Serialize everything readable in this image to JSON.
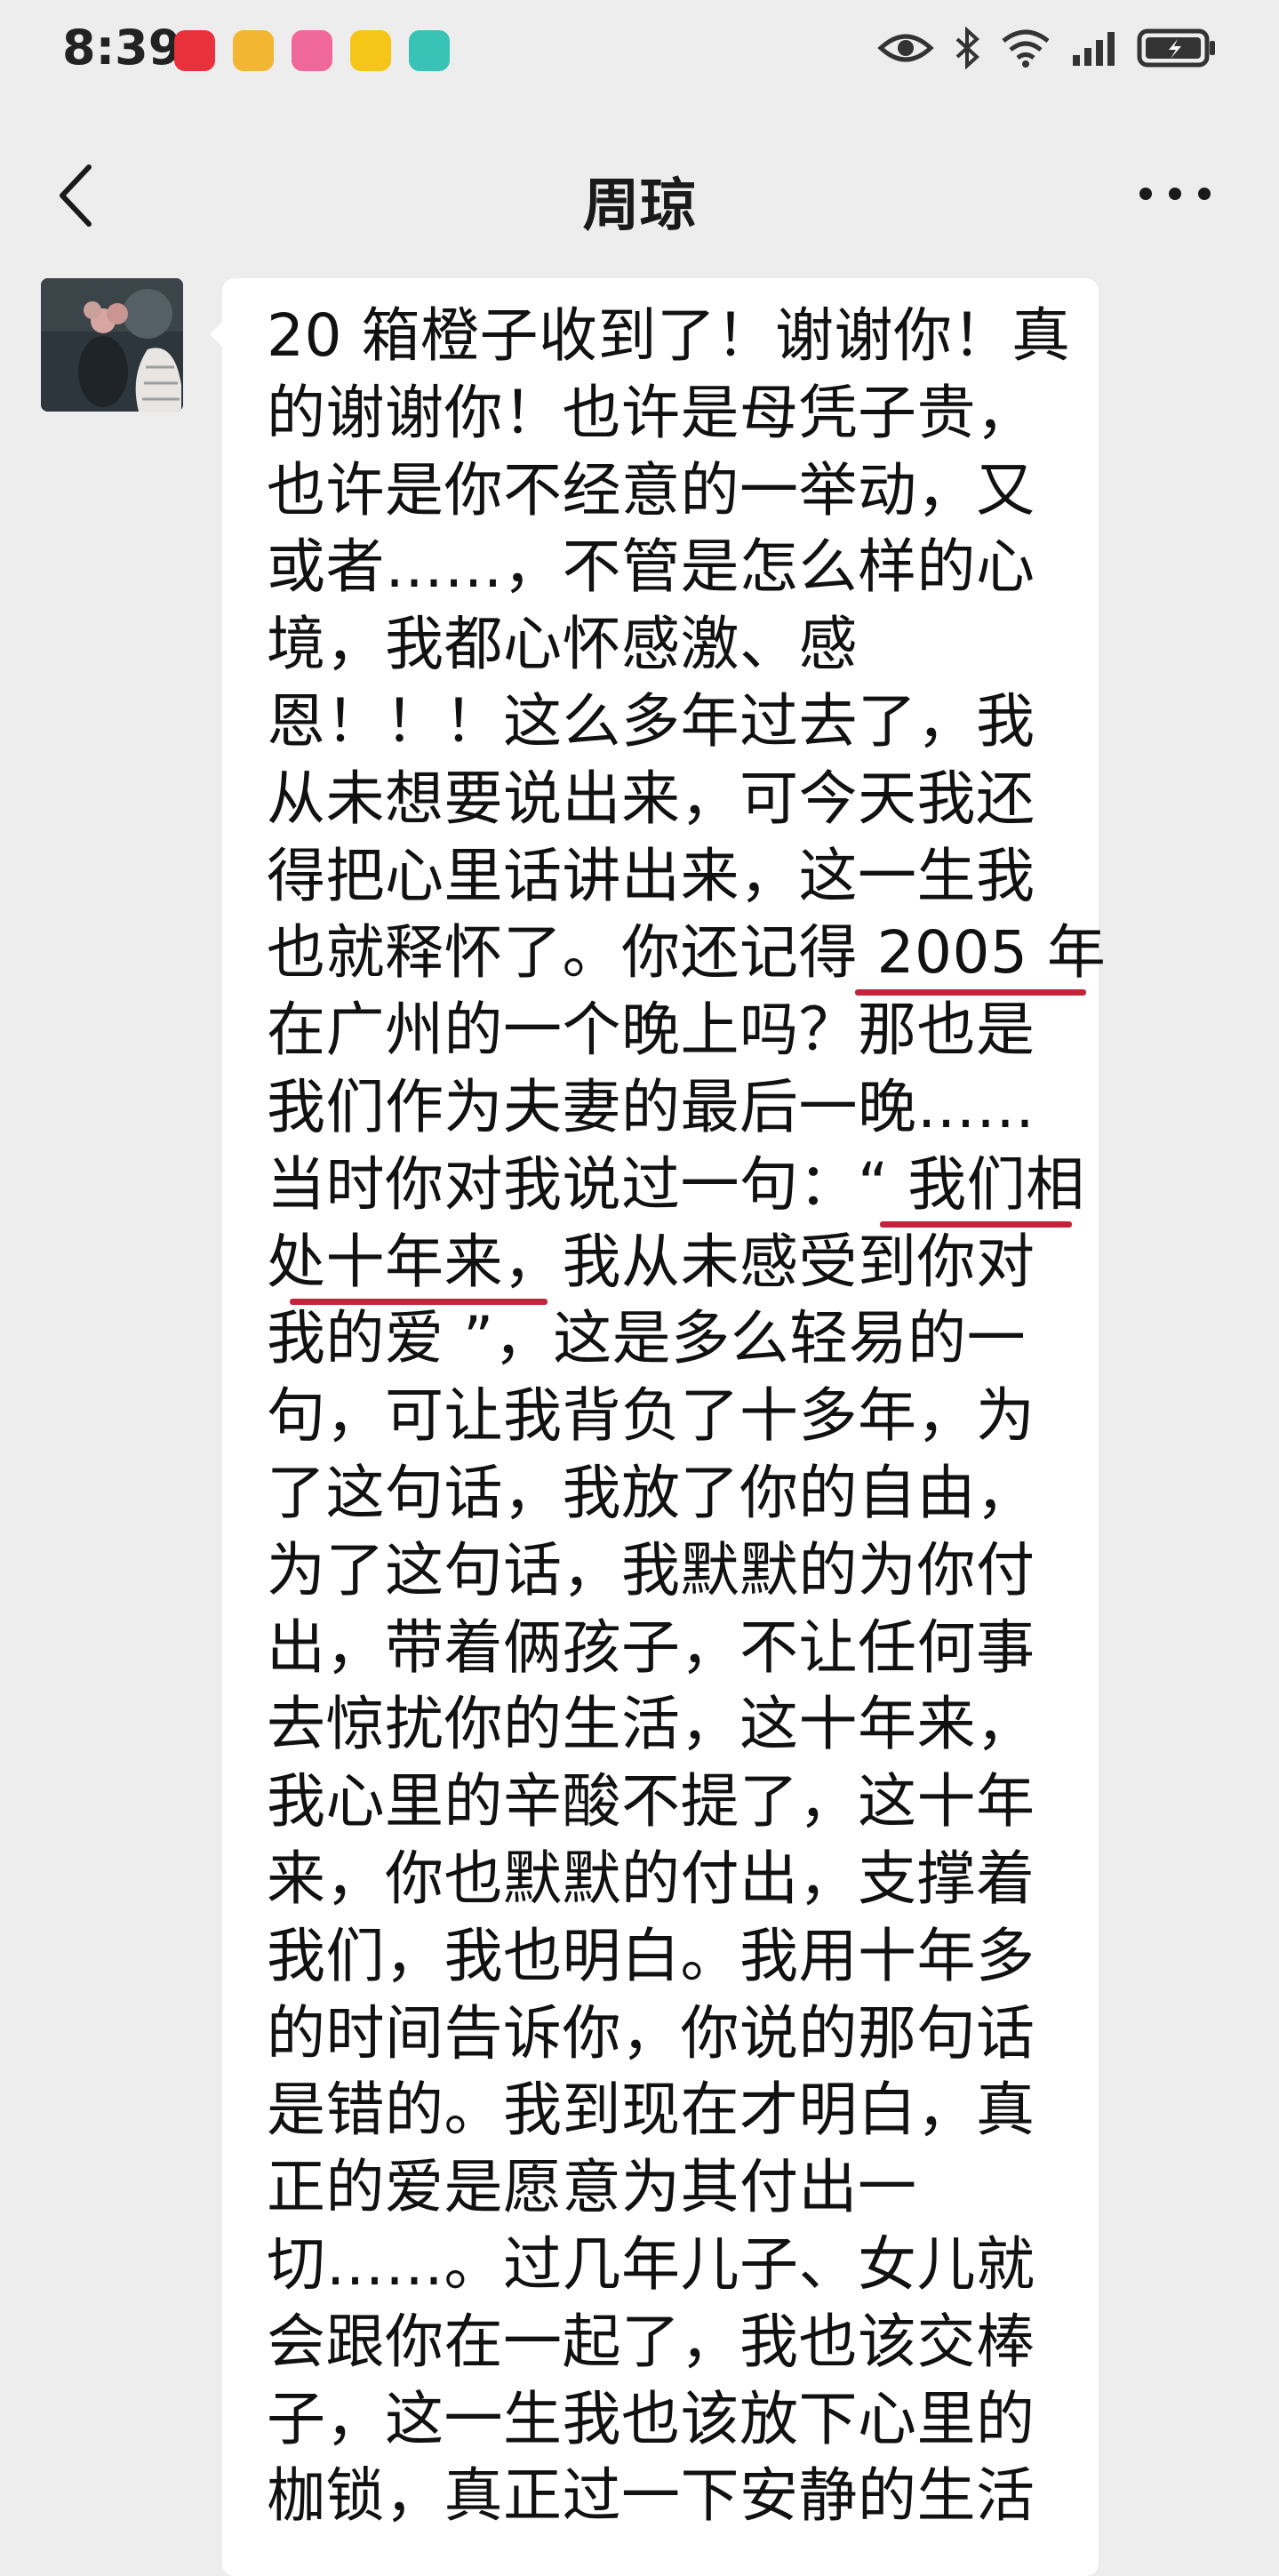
{
  "status_bar": {
    "time": "8:39",
    "app_icons": [
      {
        "name": "huawei-app-icon",
        "color": "#e8313a"
      },
      {
        "name": "game-app-icon",
        "color": "#f2b632"
      },
      {
        "name": "bilibili-app-icon",
        "color": "#f0679a"
      },
      {
        "name": "weibo-app-icon",
        "color": "#f5c518"
      },
      {
        "name": "ai-app-icon",
        "color": "#38c3b6"
      }
    ],
    "icons": [
      "eye-icon",
      "bluetooth-icon",
      "wifi-icon",
      "signal-icon",
      "battery-icon"
    ]
  },
  "nav": {
    "title": "周琼",
    "back_icon": "chevron-left-icon",
    "more_icon": "more-dots-icon"
  },
  "message": {
    "lines": [
      "20 箱橙子收到了！谢谢你！真",
      "的谢谢你！也许是母凭子贵，",
      "也许是你不经意的一举动，又",
      "或者……，不管是怎么样的心",
      "境，我都心怀感激、感",
      "恩！！！这么多年过去了，我",
      "从未想要说出来，可今天我还",
      "得把心里话讲出来，这一生我",
      "也就释怀了。你还记得 2005 年",
      "在广州的一个晚上吗？那也是",
      "我们作为夫妻的最后一晚……",
      "当时你对我说过一句：“ 我们相",
      "处十年来，我从未感受到你对",
      "我的爱 ”，这是多么轻易的一",
      "句，可让我背负了十多年，为",
      "了这句话，我放了你的自由，",
      "为了这句话，我默默的为你付",
      "出，带着俩孩子，不让任何事",
      "去惊扰你的生活，这十年来，",
      "我心里的辛酸不提了，这十年",
      "来，你也默默的付出，支撑着",
      "我们，我也明白。我用十年多",
      "的时间告诉你，你说的那句话",
      "是错的。我到现在才明白，真",
      "正的爱是愿意为其付出一",
      "切……。过几年儿子、女儿就",
      "会跟你在一起了，我也该交棒",
      "子，这一生我也该放下心里的",
      "枷锁，真正过一下安静的生活"
    ],
    "highlight_color": "#c5233b"
  }
}
